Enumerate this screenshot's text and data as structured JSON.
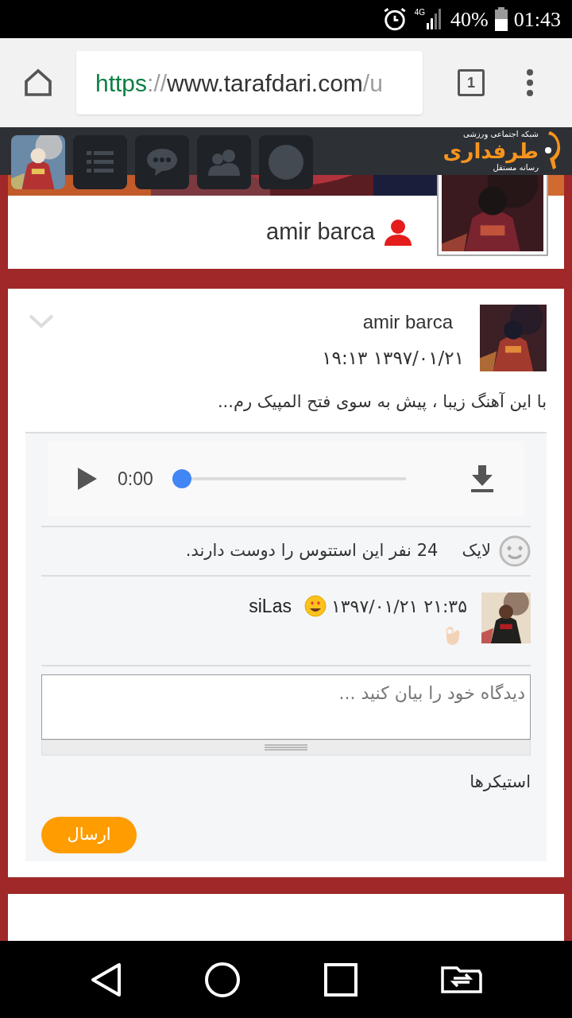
{
  "status_bar": {
    "network": "4G",
    "battery": "40%",
    "time": "01:43"
  },
  "browser": {
    "url": {
      "scheme": "https",
      "separator": "://",
      "host": "www.tarafdari.com",
      "path": "/u"
    },
    "tab_count": "1"
  },
  "site_header": {
    "logo": {
      "tagline": "شبکه اجتماعی ورزشی",
      "name": "طرفداری",
      "subtitle": "رسانه مستقل"
    }
  },
  "profile": {
    "name": "amir barca"
  },
  "post": {
    "author": "amir barca",
    "date": "۱۳۹۷/۰۱/۲۱ ۱۹:۱۳",
    "text": "با این آهنگ زیبا ، پیش به سوی فتح المپیک رم...",
    "audio": {
      "time": "0:00",
      "level": 0
    },
    "likes": {
      "label": "لایک",
      "summary": "24 نفر این استتوس را دوست دارند."
    },
    "comments": [
      {
        "author": "siLas",
        "date": "۲۱:۳۵ ۱۳۹۷/۰۱/۲۱"
      }
    ],
    "comment_form": {
      "placeholder": "دیدگاه خود را بیان کنید ...",
      "stickers_label": "استیکرها",
      "submit": "ارسال"
    }
  }
}
